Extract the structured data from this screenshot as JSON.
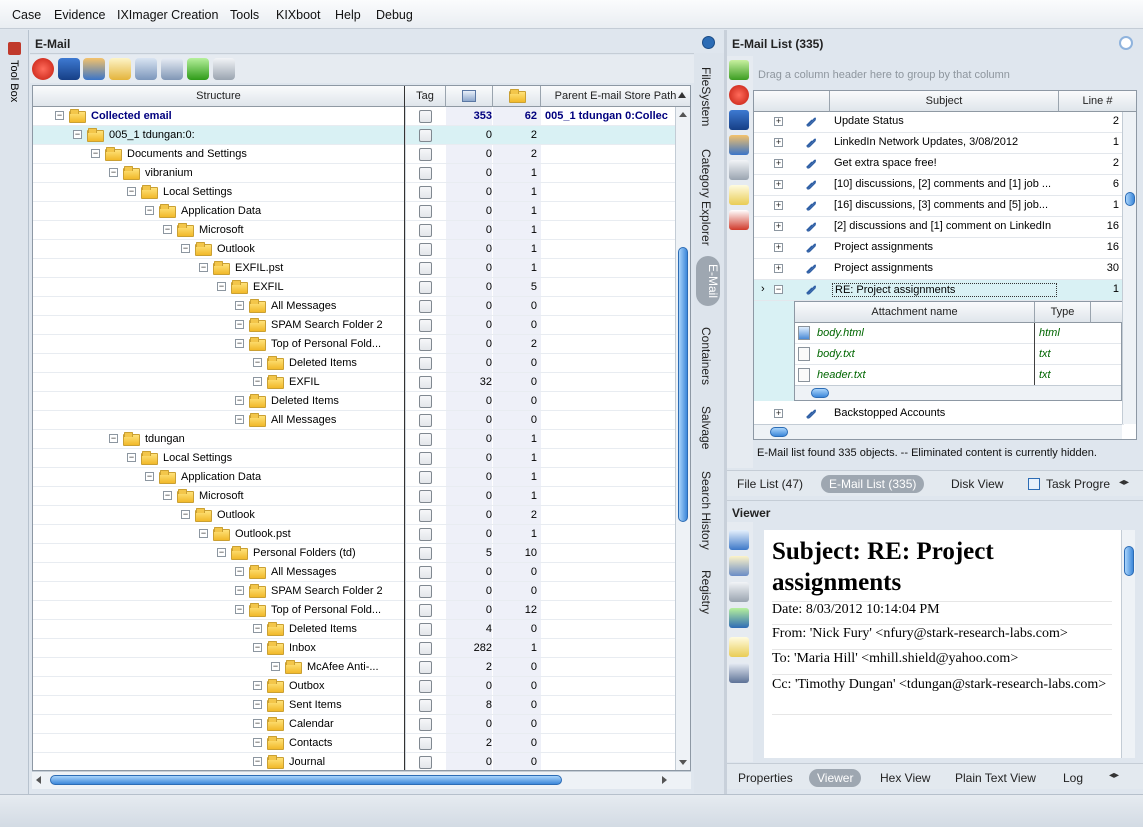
{
  "menu": [
    "Case",
    "Evidence",
    "IXImager Creation",
    "Tools",
    "KIXboot",
    "Help",
    "Debug"
  ],
  "toolbox_label": "Tool Box",
  "left_panel": {
    "title": "E-Mail",
    "columns": {
      "structure": "Structure",
      "tag": "Tag",
      "parent_path": "Parent E-mail Store Path"
    },
    "rows": [
      {
        "label": "Collected email",
        "n1": "353",
        "n2": "62",
        "path": "005_1 tdungan 0:Collec",
        "depth": 0,
        "bold": true
      },
      {
        "label": "005_1 tdungan:0:",
        "n1": "0",
        "n2": "2",
        "path": "",
        "depth": 1
      },
      {
        "label": "Documents and Settings",
        "n1": "0",
        "n2": "2",
        "path": "",
        "depth": 2
      },
      {
        "label": "vibranium",
        "n1": "0",
        "n2": "1",
        "path": "",
        "depth": 3
      },
      {
        "label": "Local Settings",
        "n1": "0",
        "n2": "1",
        "path": "",
        "depth": 4
      },
      {
        "label": "Application Data",
        "n1": "0",
        "n2": "1",
        "path": "",
        "depth": 5
      },
      {
        "label": "Microsoft",
        "n1": "0",
        "n2": "1",
        "path": "",
        "depth": 6
      },
      {
        "label": "Outlook",
        "n1": "0",
        "n2": "1",
        "path": "",
        "depth": 7
      },
      {
        "label": "EXFIL.pst",
        "n1": "0",
        "n2": "1",
        "path": "",
        "depth": 8
      },
      {
        "label": "EXFIL",
        "n1": "0",
        "n2": "5",
        "path": "",
        "depth": 9
      },
      {
        "label": "All Messages",
        "n1": "0",
        "n2": "0",
        "path": "",
        "depth": 10
      },
      {
        "label": "SPAM Search Folder 2",
        "n1": "0",
        "n2": "0",
        "path": "",
        "depth": 10
      },
      {
        "label": "Top of Personal Fold...",
        "n1": "0",
        "n2": "2",
        "path": "",
        "depth": 10
      },
      {
        "label": "Deleted Items",
        "n1": "0",
        "n2": "0",
        "path": "",
        "depth": 11
      },
      {
        "label": "EXFIL",
        "n1": "32",
        "n2": "0",
        "path": "",
        "depth": 11
      },
      {
        "label": "Deleted Items",
        "n1": "0",
        "n2": "0",
        "path": "",
        "depth": 10
      },
      {
        "label": "All Messages",
        "n1": "0",
        "n2": "0",
        "path": "",
        "depth": 10
      },
      {
        "label": "tdungan",
        "n1": "0",
        "n2": "1",
        "path": "",
        "depth": 3
      },
      {
        "label": "Local Settings",
        "n1": "0",
        "n2": "1",
        "path": "",
        "depth": 4
      },
      {
        "label": "Application Data",
        "n1": "0",
        "n2": "1",
        "path": "",
        "depth": 5
      },
      {
        "label": "Microsoft",
        "n1": "0",
        "n2": "1",
        "path": "",
        "depth": 6
      },
      {
        "label": "Outlook",
        "n1": "0",
        "n2": "2",
        "path": "",
        "depth": 7
      },
      {
        "label": "Outlook.pst",
        "n1": "0",
        "n2": "1",
        "path": "",
        "depth": 8
      },
      {
        "label": "Personal Folders (td)",
        "n1": "5",
        "n2": "10",
        "path": "",
        "depth": 9
      },
      {
        "label": "All Messages",
        "n1": "0",
        "n2": "0",
        "path": "",
        "depth": 10
      },
      {
        "label": "SPAM Search Folder 2",
        "n1": "0",
        "n2": "0",
        "path": "",
        "depth": 10
      },
      {
        "label": "Top of Personal Fold...",
        "n1": "0",
        "n2": "12",
        "path": "",
        "depth": 10
      },
      {
        "label": "Deleted Items",
        "n1": "4",
        "n2": "0",
        "path": "",
        "depth": 11
      },
      {
        "label": "Inbox",
        "n1": "282",
        "n2": "1",
        "path": "",
        "depth": 11
      },
      {
        "label": "McAfee Anti-...",
        "n1": "2",
        "n2": "0",
        "path": "",
        "depth": 12
      },
      {
        "label": "Outbox",
        "n1": "0",
        "n2": "0",
        "path": "",
        "depth": 11
      },
      {
        "label": "Sent Items",
        "n1": "8",
        "n2": "0",
        "path": "",
        "depth": 11
      },
      {
        "label": "Calendar",
        "n1": "0",
        "n2": "0",
        "path": "",
        "depth": 11
      },
      {
        "label": "Contacts",
        "n1": "2",
        "n2": "0",
        "path": "",
        "depth": 11
      },
      {
        "label": "Journal",
        "n1": "0",
        "n2": "0",
        "path": "",
        "depth": 11
      }
    ]
  },
  "side_tabs": [
    "FileSystem",
    "Category Explorer",
    "E-Mail",
    "Containers",
    "Salvage",
    "Search History",
    "Registry"
  ],
  "email_list": {
    "title": "E-Mail List (335)",
    "group_hint": "Drag a column header here to group by that column",
    "columns": {
      "subject": "Subject",
      "line": "Line #"
    },
    "rows": [
      {
        "subject": "Update Status",
        "line": "2"
      },
      {
        "subject": "LinkedIn Network Updates, 3/08/2012",
        "line": "1"
      },
      {
        "subject": "Get extra space free!",
        "line": "2"
      },
      {
        "subject": "[10] discussions, [2] comments and [1] job ...",
        "line": "6"
      },
      {
        "subject": "[16] discussions, [3] comments and [5] job...",
        "line": "1"
      },
      {
        "subject": "[2] discussions and [1] comment on LinkedIn",
        "line": "16"
      },
      {
        "subject": "Project assignments",
        "line": "16"
      },
      {
        "subject": "Project assignments",
        "line": "30"
      },
      {
        "subject": "RE: Project assignments",
        "line": "1"
      }
    ],
    "attachments": {
      "columns": {
        "name": "Attachment name",
        "type": "Type"
      },
      "rows": [
        {
          "name": "body.html",
          "type": "html"
        },
        {
          "name": "body.txt",
          "type": "txt"
        },
        {
          "name": "header.txt",
          "type": "txt"
        }
      ]
    },
    "last_row": {
      "subject": "Backstopped Accounts",
      "line": ""
    },
    "status": "E-Mail list found 335 objects. -- Eliminated content is currently hidden."
  },
  "list_tabs": [
    "File List (47)",
    "E-Mail List (335)",
    "Disk View",
    "Task Progre"
  ],
  "viewer": {
    "title": "Viewer",
    "subject": "Subject: RE: Project assignments",
    "date": "Date: 8/03/2012 10:14:04 PM",
    "from": "From: 'Nick Fury' <nfury@stark-research-labs.com>",
    "to": "To: 'Maria Hill' <mhill.shield@yahoo.com>",
    "cc": "Cc: 'Timothy Dungan' <tdungan@stark-research-labs.com>",
    "tabs": [
      "Properties",
      "Viewer",
      "Hex View",
      "Plain Text View",
      "Log"
    ]
  },
  "colors": {
    "accent": "#3d88da",
    "selected_row": "#d9f1f4",
    "link_blue": "#00007f",
    "attach_green": "#006600"
  }
}
